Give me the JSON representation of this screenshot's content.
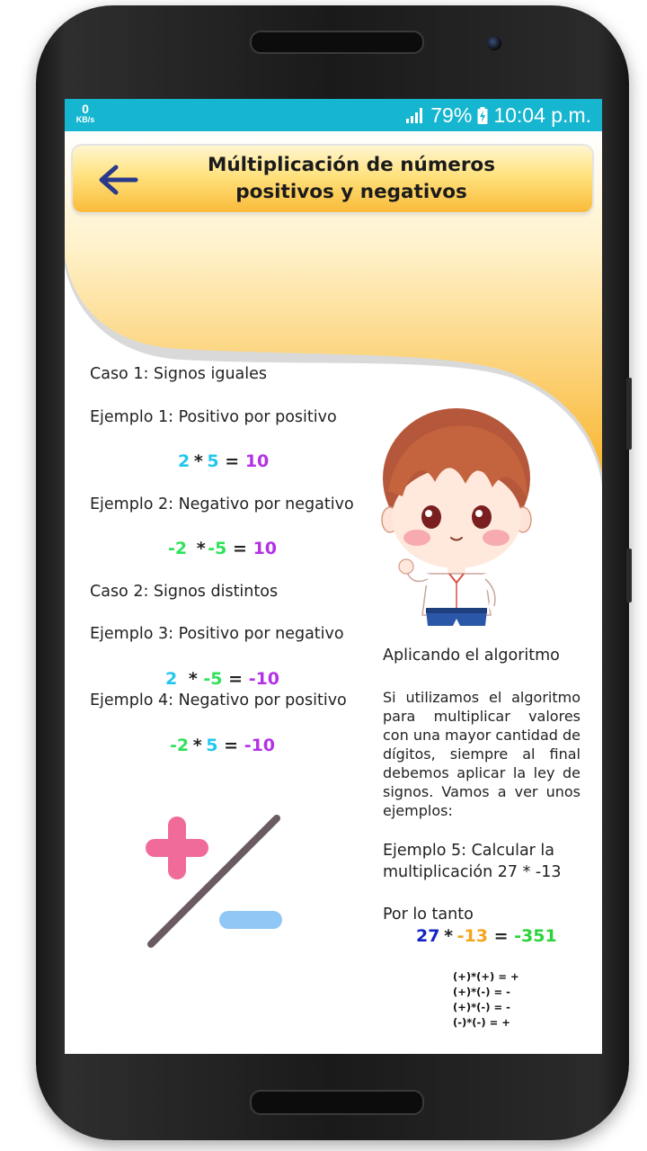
{
  "status_bar": {
    "network_speed_value": "0",
    "network_speed_unit": "KB/s",
    "battery": "79%",
    "time": "10:04 p.m.",
    "icons": [
      "signal-icon",
      "battery-charging-icon"
    ]
  },
  "header": {
    "title_line1": "Múltiplicación de números",
    "title_line2": "positivos y negativos",
    "back_icon": "arrow-left-icon",
    "colors": {
      "bar_top": "#fff6cf",
      "bar_bottom": "#f9bb3a",
      "arrow": "#2a3a8a"
    }
  },
  "content": {
    "caso1": "Caso 1: Signos iguales",
    "ejemplo1": {
      "label": "Ejemplo 1: Positivo por positivo",
      "a": "2",
      "op": "*",
      "b": "5",
      "eq": "=",
      "result": "10"
    },
    "ejemplo2": {
      "label": "Ejemplo 2: Negativo por negativo",
      "a": "-2",
      "op": "*",
      "b": "-5",
      "eq": "=",
      "result": "10"
    },
    "caso2": "Caso 2: Signos distintos",
    "ejemplo3": {
      "label": "Ejemplo 3: Positivo por negativo",
      "a": "2",
      "op": "*",
      "b": "-5",
      "eq": "=",
      "result": "-10"
    },
    "ejemplo4": {
      "label": "Ejemplo 4: Negativo por positivo",
      "a": "-2",
      "op": "*",
      "b": "5",
      "eq": "=",
      "result": "-10"
    },
    "aplicando": "Aplicando el algoritmo",
    "paragraph": "Si utilizamos el algoritmo para multiplicar valores con una mayor cantidad de dígitos, siempre al final debemos aplicar la ley de signos. Vamos a ver unos ejemplos:",
    "ejemplo5_line1": "Ejemplo 5: Calcular la",
    "ejemplo5_line2": "multiplicación 27 * -13",
    "por_lo_tanto": "Por lo tanto",
    "final_eq": {
      "a": "27",
      "op": "*",
      "b": "-13",
      "eq": "=",
      "result": "-351"
    },
    "sign_rules": [
      "(+)*(+) = +",
      "(+)*(-) = -",
      "(+)*(-) = -",
      "(-)*(-) = +"
    ]
  },
  "illustrations": {
    "character": "cartoon-boy-illustration",
    "plus_minus": "plus-minus-sign-illustration"
  }
}
